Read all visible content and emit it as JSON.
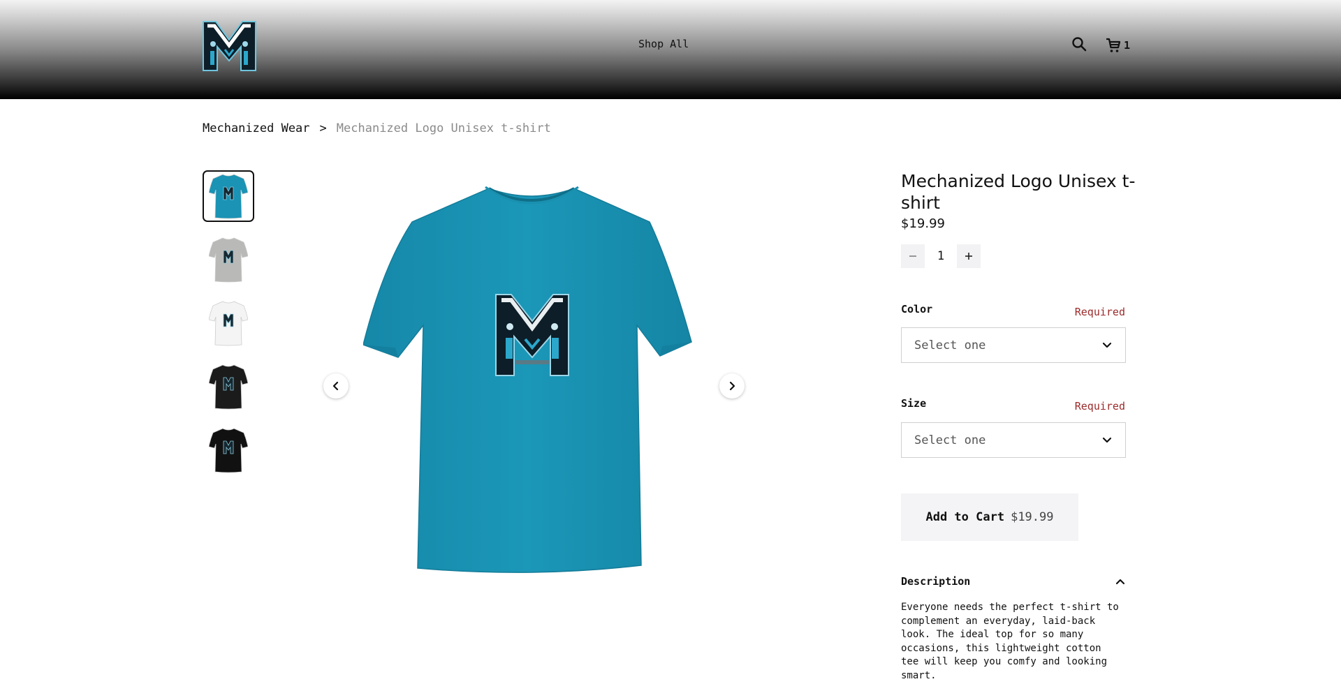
{
  "header": {
    "nav": {
      "shop_all": "Shop All"
    },
    "cart_count": "1"
  },
  "breadcrumb": {
    "parent": "Mechanized Wear",
    "separator": ">",
    "current": "Mechanized Logo Unisex t-shirt"
  },
  "gallery": {
    "thumbnails": [
      {
        "color": "#1a93b4",
        "selected": true
      },
      {
        "color": "#b9b9b7",
        "selected": false
      },
      {
        "color": "#f4f4f4",
        "selected": false
      },
      {
        "color": "#1b1b1b",
        "selected": false
      },
      {
        "color": "#111111",
        "selected": false
      }
    ]
  },
  "product": {
    "title": "Mechanized Logo Unisex t-shirt",
    "price": "$19.99",
    "quantity": "1",
    "color_label": "Color",
    "color_required": "Required",
    "color_placeholder": "Select one",
    "size_label": "Size",
    "size_required": "Required",
    "size_placeholder": "Select one",
    "add_to_cart_label": "Add to Cart",
    "add_to_cart_price": "$19.99",
    "description_title": "Description",
    "description_text": "Everyone needs the perfect t-shirt to complement an everyday, laid-back look. The ideal top for so many occasions, this lightweight cotton tee will keep you comfy and looking smart."
  },
  "colors": {
    "shirt_blue": "#1a93b4",
    "required_red": "#9c2a2a",
    "button_bg": "#f4f4f6"
  }
}
